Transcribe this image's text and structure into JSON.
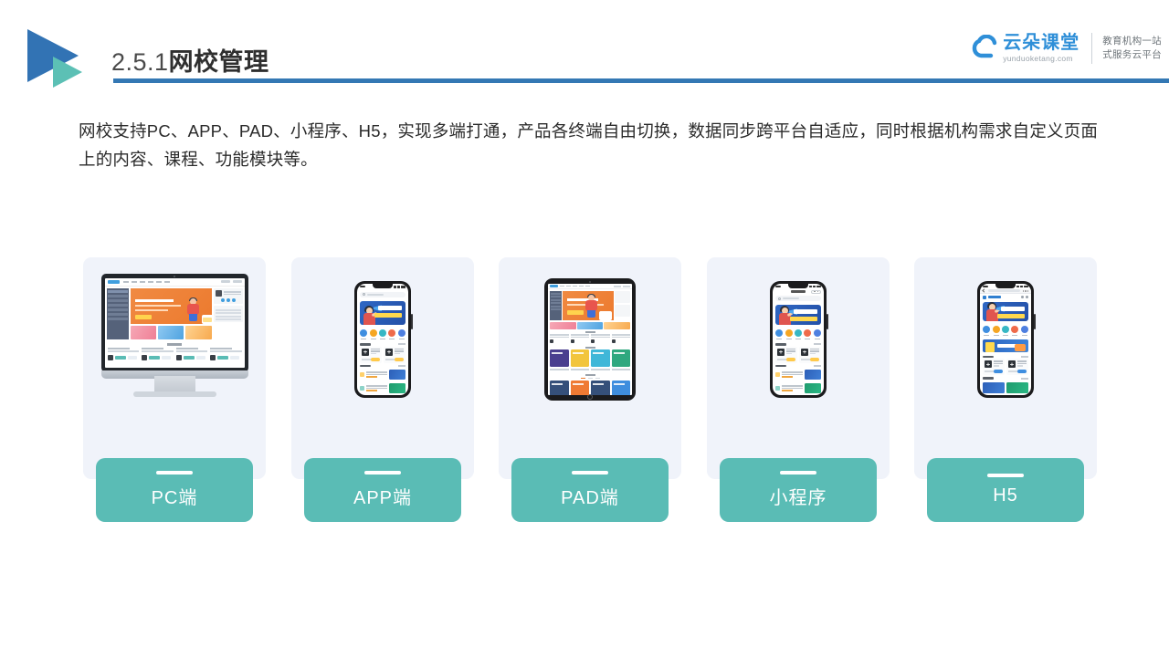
{
  "header": {
    "section_number": "2.5.1",
    "section_title": "网校管理",
    "logo_icon": "double-play-triangle-logo",
    "rule_color": "#3478b4"
  },
  "brand": {
    "icon": "cloud-icon",
    "name_cn": "云朵课堂",
    "name_en": "yunduoketang.com",
    "tagline_line1": "教育机构一站",
    "tagline_line2": "式服务云平台",
    "color": "#2f8fd8"
  },
  "body": {
    "paragraph": "网校支持PC、APP、PAD、小程序、H5，实现多端打通，产品各终端自由切换，数据同步跨平台自适应，同时根据机构需求自定义页面上的内容、课程、功能模块等。"
  },
  "cards": [
    {
      "label": "PC端",
      "device": "desktop-monitor",
      "device_icon": "monitor-icon"
    },
    {
      "label": "APP端",
      "device": "smartphone",
      "device_icon": "phone-icon"
    },
    {
      "label": "PAD端",
      "device": "tablet",
      "device_icon": "tablet-icon"
    },
    {
      "label": "小程序",
      "device": "smartphone-miniprogram",
      "device_icon": "phone-icon"
    },
    {
      "label": "H5",
      "device": "smartphone-h5",
      "device_icon": "phone-icon"
    }
  ],
  "theme": {
    "label_bar_color": "#5abcb5",
    "card_background": "#f0f3fa",
    "accent_blue": "#3478b4",
    "banner_blue": "#2f67c4",
    "banner_orange": "#ec7a2e"
  },
  "mockup_text": {
    "app_banner_line1": "职场人的",
    "app_banner_line2": "第一堂沟通课"
  }
}
